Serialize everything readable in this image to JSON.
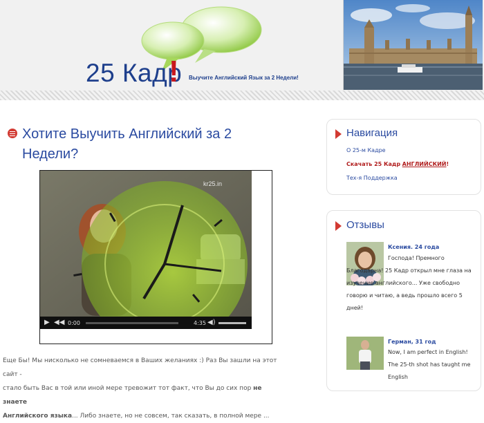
{
  "header": {
    "logo_title": "25 Кадр",
    "logo_exclaim": "!",
    "tagline": "Выучите Английский Язык за 2 Недели!"
  },
  "post": {
    "title": "Хотите Выучить Английский за 2 Недели?",
    "video": {
      "watermark": "kr25.in",
      "time_current": "0:00",
      "time_total": "4:35"
    },
    "excerpt_line1": "Еще Бы! Мы нисколько не сомневаемся в Ваших желаниях :) Раз Вы зашли на этот сайт -",
    "excerpt_line2": "стало быть Вас в той или иной мере тревожит тот факт, что Вы до сих пор",
    "excerpt_line2_bold": "не знаете",
    "excerpt_line3_bold": "Английского языка",
    "excerpt_line3": "... Либо знаете, но не совсем, так сказать, в полной мере ..."
  },
  "sidebar": {
    "nav": {
      "heading": "Навигация",
      "items": [
        "О 25-м Кадре",
        "Скачать 25 Кадр",
        "АНГЛИЙСКИЙ",
        "!",
        "Тех-я Поддержка"
      ]
    },
    "reviews": {
      "heading": "Отзывы",
      "items": [
        {
          "name": "Ксения. 24 года",
          "text": "Господа! Премного Благодарна! 25 Кадр открыл мне глаза на изучение английского... Уже свободно говорю и читаю, а ведь прошло всего 5 дней!"
        },
        {
          "name": "Герман, 31 год",
          "text": "Now, I am perfect in English! The 25-th shot has taught me English"
        }
      ]
    }
  },
  "colors": {
    "accent_red": "#d23a32",
    "link_blue": "#2a4aa0",
    "bubble_green": "#a6d65a"
  }
}
